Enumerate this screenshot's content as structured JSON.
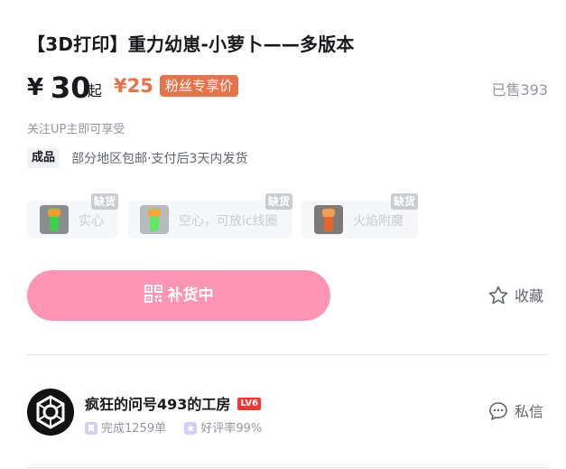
{
  "product": {
    "title": "【3D打印】重力幼崽-小萝卜——多版本",
    "price_symbol": "¥",
    "price": "30",
    "price_suffix": "起",
    "fan_price": "¥25",
    "fan_badge": "粉丝专享价",
    "sold": "已售393",
    "follow_tip": "关注UP主即可享受",
    "tag": "成品",
    "shipping": "部分地区包邮·支付后3天内发货"
  },
  "variants": [
    {
      "label": "实心",
      "status": "缺货"
    },
    {
      "label": "空心，可放ic线圈",
      "status": "缺货"
    },
    {
      "label": "火焰附魔",
      "status": "缺货"
    }
  ],
  "actions": {
    "restock_label": "补货中",
    "favorite_label": "收藏",
    "message_label": "私信"
  },
  "shop": {
    "name": "疯狂的问号493的工房",
    "level": "LV6",
    "completed": "完成1259单",
    "rating": "好评率99%"
  },
  "colors": {
    "fan_accent": "#e8734a",
    "restock_button": "#ff94b4",
    "level_badge": "#ff3333"
  },
  "icons": {
    "restock": "qr-code-icon",
    "favorite": "star-outline-icon",
    "message": "chat-bubble-icon"
  }
}
